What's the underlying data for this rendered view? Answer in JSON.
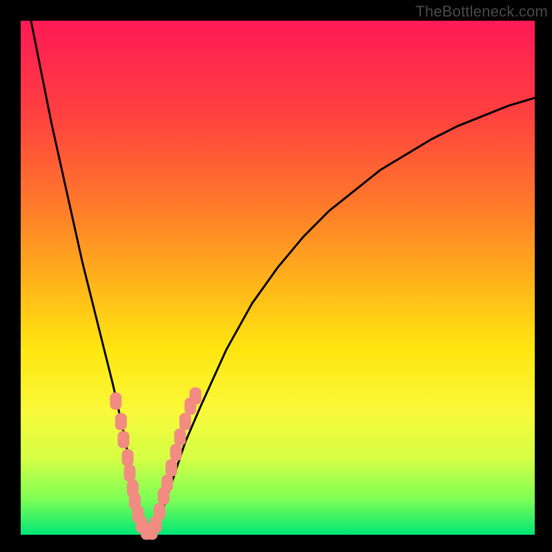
{
  "watermark": "TheBottleneck.com",
  "colors": {
    "frame": "#000000",
    "curve": "#000000",
    "marker_fill": "#f28b82",
    "marker_stroke": "#f28b82"
  },
  "chart_data": {
    "type": "line",
    "title": "",
    "xlabel": "",
    "ylabel": "",
    "xlim": [
      0,
      100
    ],
    "ylim": [
      0,
      100
    ],
    "grid": false,
    "annotations": [
      "TheBottleneck.com"
    ],
    "series": [
      {
        "name": "bottleneck-curve",
        "x": [
          2,
          4,
          6,
          8,
          10,
          12,
          14,
          16,
          18,
          20,
          21,
          22,
          23,
          24,
          25,
          26,
          28,
          30,
          32,
          35,
          40,
          45,
          50,
          55,
          60,
          65,
          70,
          75,
          80,
          85,
          90,
          95,
          100
        ],
        "y": [
          100,
          90,
          80,
          71,
          62,
          53,
          45,
          37,
          29,
          20,
          15,
          10,
          5,
          1,
          0,
          1,
          6,
          12,
          18,
          25,
          36,
          45,
          52,
          58,
          63,
          67,
          71,
          74,
          77,
          79.5,
          81.5,
          83.5,
          85
        ]
      }
    ],
    "markers": [
      {
        "x": 18.5,
        "y": 26
      },
      {
        "x": 19.5,
        "y": 22
      },
      {
        "x": 20.0,
        "y": 18.5
      },
      {
        "x": 20.8,
        "y": 15
      },
      {
        "x": 21.2,
        "y": 12
      },
      {
        "x": 21.8,
        "y": 9
      },
      {
        "x": 22.2,
        "y": 6.5
      },
      {
        "x": 22.8,
        "y": 4
      },
      {
        "x": 23.5,
        "y": 2
      },
      {
        "x": 24.5,
        "y": 0.7
      },
      {
        "x": 25.5,
        "y": 0.7
      },
      {
        "x": 26.3,
        "y": 2
      },
      {
        "x": 27.0,
        "y": 4.5
      },
      {
        "x": 27.8,
        "y": 7.5
      },
      {
        "x": 28.5,
        "y": 10
      },
      {
        "x": 29.3,
        "y": 13
      },
      {
        "x": 30.2,
        "y": 16
      },
      {
        "x": 31.0,
        "y": 19
      },
      {
        "x": 32.0,
        "y": 22
      },
      {
        "x": 33.0,
        "y": 25
      },
      {
        "x": 34.0,
        "y": 27
      }
    ]
  }
}
